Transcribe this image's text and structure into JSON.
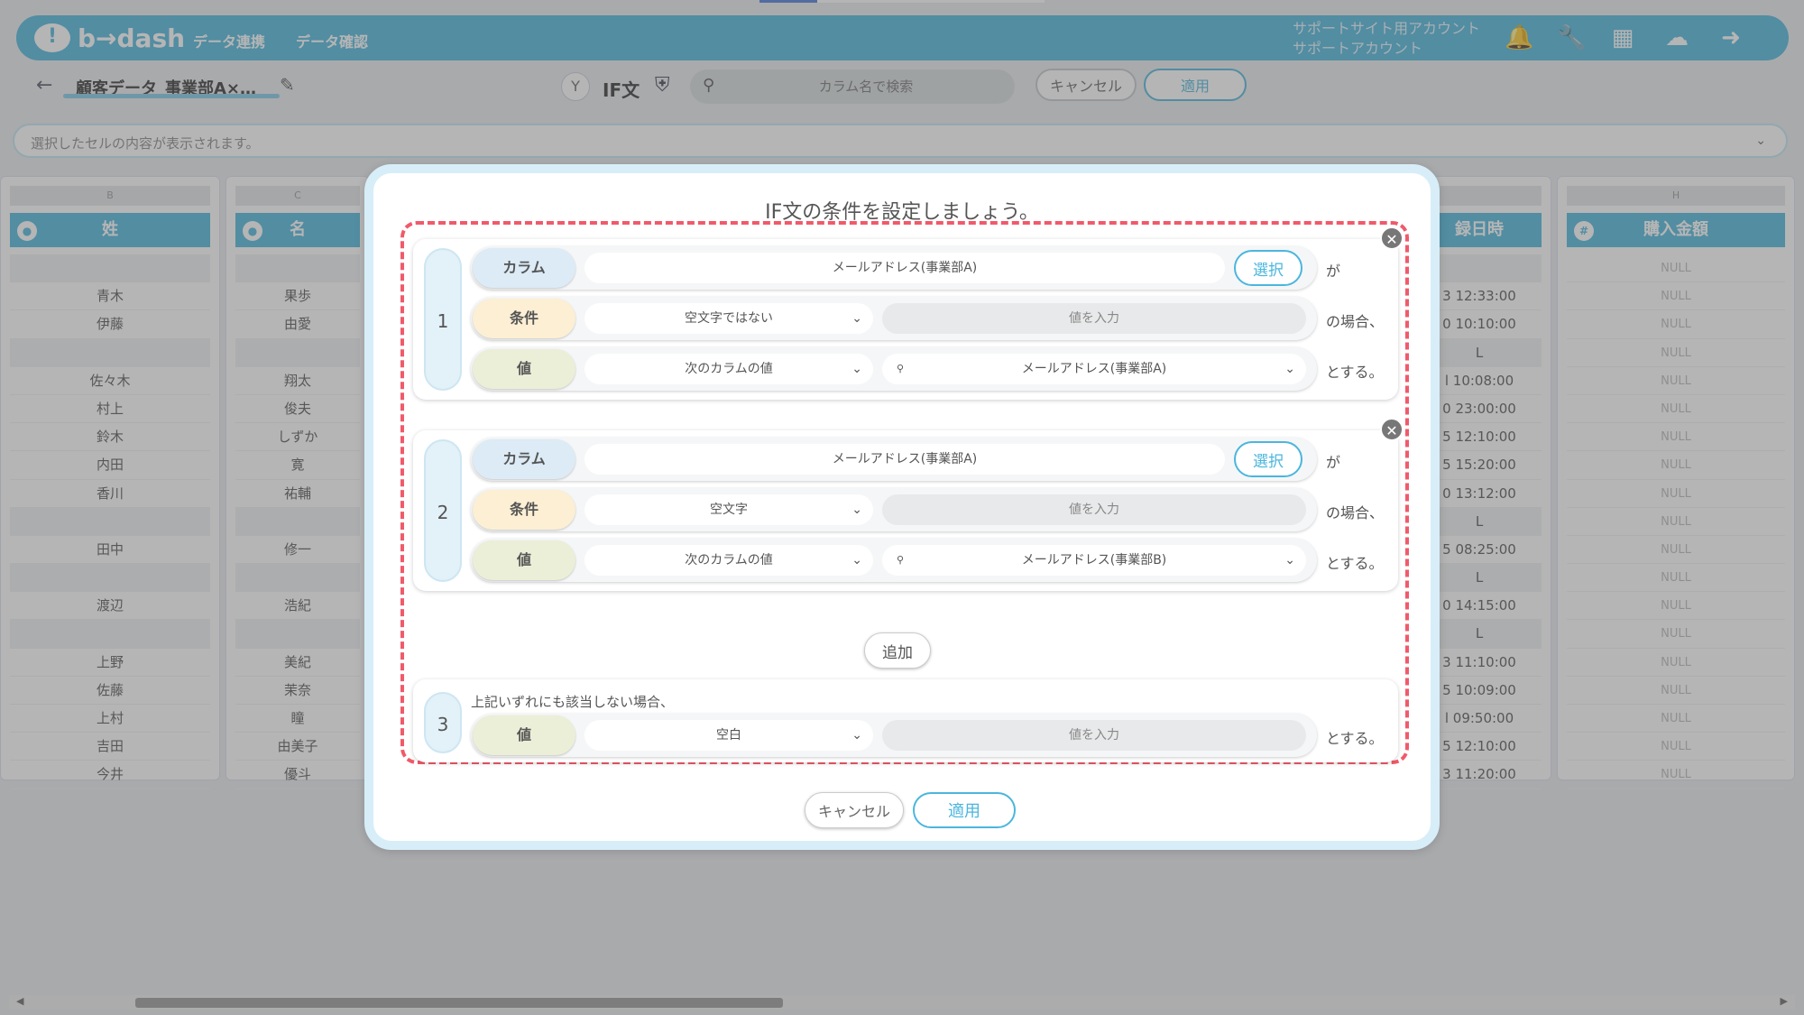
{
  "app": {
    "logo": "b→dash",
    "nav": [
      "データ連携",
      "データ確認"
    ],
    "account_line1": "サポートサイト用アカウント",
    "account_line2": "サポートアカウント"
  },
  "toolbar": {
    "file_title": "顧客データ_事業部A×…",
    "if_label": "IF文",
    "search_placeholder": "カラム名で検索",
    "cancel": "キャンセル",
    "apply": "適用"
  },
  "cellbar": {
    "placeholder": "選択したセルの内容が表示されます。"
  },
  "columns": [
    {
      "letter": "B",
      "header": "姓",
      "rows": [
        "",
        "青木",
        "伊藤",
        "",
        "佐々木",
        "村上",
        "鈴木",
        "内田",
        "香川",
        "",
        "田中",
        "",
        "渡辺",
        "",
        "上野",
        "佐藤",
        "上村",
        "吉田",
        "今井"
      ]
    },
    {
      "letter": "C",
      "header": "名",
      "rows": [
        "",
        "果歩",
        "由愛",
        "",
        "翔太",
        "俊夫",
        "しずか",
        "寛",
        "祐輔",
        "",
        "修一",
        "",
        "浩紀",
        "",
        "美紀",
        "茉奈",
        "瞳",
        "由美子",
        "優斗"
      ]
    },
    {
      "letter": "",
      "header": "録日時",
      "rows": [
        "",
        "3 12:33:00",
        "0 10:10:00",
        "L",
        "l 10:08:00",
        "0 23:00:00",
        "5 12:10:00",
        "5 15:20:00",
        "0 13:12:00",
        "L",
        "5 08:25:00",
        "L",
        "0 14:15:00",
        "L",
        "3 11:10:00",
        "5 10:09:00",
        "l 09:50:00",
        "5 12:10:00",
        "3 11:20:00"
      ]
    },
    {
      "letter": "H",
      "header": "購入金額",
      "rows": [
        "NULL",
        "NULL",
        "NULL",
        "NULL",
        "NULL",
        "NULL",
        "NULL",
        "NULL",
        "NULL",
        "NULL",
        "NULL",
        "NULL",
        "NULL",
        "NULL",
        "NULL",
        "NULL",
        "NULL",
        "NULL",
        "NULL"
      ]
    }
  ],
  "modal": {
    "title": "IF文の条件を設定しましょう。",
    "labels": {
      "column": "カラム",
      "condition": "条件",
      "value": "値"
    },
    "choose": "選択",
    "suffix_ga": "が",
    "suffix_case": "の場合、",
    "suffix_suru": "とする。",
    "value_placeholder": "値を入力",
    "blocks": [
      {
        "num": "1",
        "column": "メールアドレス(事業部A)",
        "condition": "空文字ではない",
        "value_type": "次のカラムの値",
        "value_column": "メールアドレス(事業部A)"
      },
      {
        "num": "2",
        "column": "メールアドレス(事業部A)",
        "condition": "空文字",
        "value_type": "次のカラムの値",
        "value_column": "メールアドレス(事業部B)"
      }
    ],
    "add": "追加",
    "else": {
      "num": "3",
      "text": "上記いずれにも該当しない場合、",
      "value_type": "空白"
    },
    "cancel": "キャンセル",
    "apply": "適用"
  }
}
